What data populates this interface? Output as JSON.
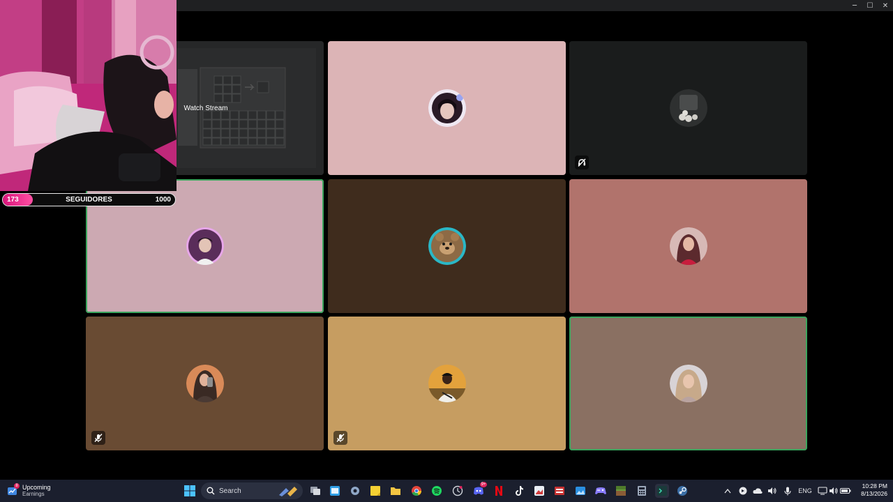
{
  "window": {
    "minimize_glyph": "─",
    "maximize_glyph": "☐",
    "close_glyph": "✕"
  },
  "stream_overlay": {
    "watch_stream_label": "Watch Stream",
    "followers_current": "173",
    "followers_label": "SEGUIDORES",
    "followers_goal": "1000",
    "followers_progress": 0.173,
    "accent": "#e8167f"
  },
  "tiles": [
    {
      "bg": "#252627",
      "content": "stream-preview",
      "speaking": false,
      "muted": false
    },
    {
      "bg": "#dcb4b6",
      "avatar": "#2a1a26",
      "speaking": false,
      "muted": false
    },
    {
      "bg": "#1a1c1c",
      "avatar": "#3b3d3d",
      "speaking": false,
      "muted": false,
      "deafened": true
    },
    {
      "bg": "#cca9b2",
      "avatar": "#5a2d5a",
      "speaking": true,
      "muted": false
    },
    {
      "bg": "#3f2c1d",
      "avatar": "#8d6a45",
      "speaking": false,
      "muted": false
    },
    {
      "bg": "#b1736c",
      "avatar": "#5c2a2e",
      "speaking": false,
      "muted": false
    },
    {
      "bg": "#694b33",
      "avatar": "#4a3a34",
      "speaking": false,
      "muted": true
    },
    {
      "bg": "#c69d61",
      "avatar": "#7a5a2a",
      "speaking": false,
      "muted": true
    },
    {
      "bg": "#8a7062",
      "avatar": "#c7a98a",
      "speaking": true,
      "muted": false
    }
  ],
  "taskbar": {
    "widget_title": "Upcoming",
    "widget_subtitle": "Earnings",
    "widget_badge": "8",
    "search_label": "Search",
    "discord_badge": "9+",
    "language": "ENG",
    "time": "10:28 PM",
    "date": "8/13/2026"
  }
}
